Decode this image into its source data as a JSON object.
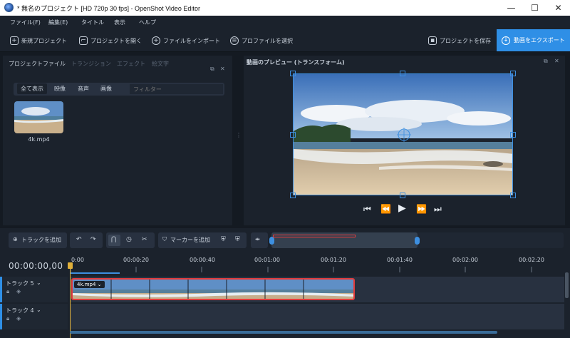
{
  "window": {
    "title": "* 無名のプロジェクト [HD 720p 30 fps] - OpenShot Video Editor",
    "minimize": "—",
    "maximize": "☐",
    "close": "✕"
  },
  "menu": [
    "ファイル(F)",
    "編集(E)",
    "タイトル",
    "表示",
    "ヘルプ"
  ],
  "toolbar": {
    "new_project": "新規プロジェクト",
    "open_project": "プロジェクトを開く",
    "import_files": "ファイルをインポート",
    "choose_profile": "プロファイルを選択",
    "save_project": "プロジェクトを保存",
    "export_video": "動画をエクスポート"
  },
  "project_panel": {
    "tabs": [
      "プロジェクトファイル",
      "トランジション",
      "エフェクト",
      "絵文字"
    ],
    "filters": [
      "全て表示",
      "映像",
      "音声",
      "画像"
    ],
    "filter_placeholder": "フィルター",
    "files": [
      {
        "name": "4k.mp4"
      }
    ]
  },
  "preview": {
    "title": "動画のプレビュー (トランスフォーム)"
  },
  "timeline_toolbar": {
    "add_track": "トラックを追加",
    "add_marker": "マーカーを追加"
  },
  "timeline": {
    "timecode": "00:00:00,00",
    "ticks": [
      "0:00",
      "00:00:20",
      "00:00:40",
      "00:01:00",
      "00:01:20",
      "00:01:40",
      "00:02:00",
      "00:02:20"
    ],
    "tracks": [
      {
        "name": "トラック 5"
      },
      {
        "name": "トラック 4"
      }
    ],
    "clip_label": "4k.mp4"
  },
  "colors": {
    "accent": "#2f8fe6",
    "clip_border": "#e23b3b",
    "playhead": "#e0b03a",
    "panel": "#1b222c",
    "background": "#141a22"
  }
}
